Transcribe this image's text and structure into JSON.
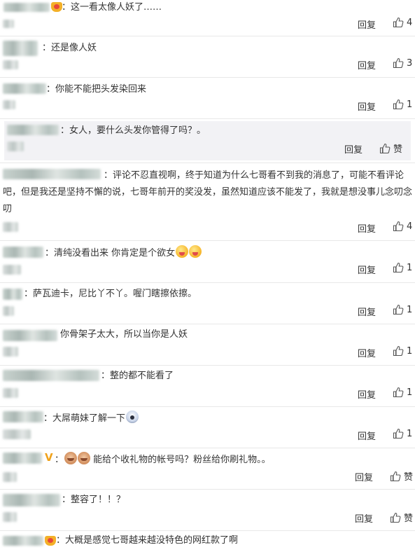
{
  "comments": [
    {
      "text": "：这一看太像人妖了……",
      "reply": "回复",
      "likes": "4"
    },
    {
      "text": "：还是像人妖",
      "reply": "回复",
      "likes": "3"
    },
    {
      "text": "：你能不能把头发染回来",
      "reply": "回复",
      "likes": "1"
    },
    {
      "text": "：女人，要什么头发你管得了吗？。",
      "reply": "回复",
      "likes": "赞"
    },
    {
      "text": "：评论不忍直视啊，终于知道为什么七哥看不到我的消息了，可能不看评论吧，但是我还是坚持不懈的说，七哥年前开的奖没发，虽然知道应该不能发了，我就是想没事儿念叨念叨",
      "reply": "回复",
      "likes": "4"
    },
    {
      "text": "：清纯没看出来 你肯定是个欲女",
      "reply": "回复",
      "likes": "1"
    },
    {
      "text": "：萨瓦迪卡，尼比丫不丫。喔门瞎擦依擦。",
      "reply": "回复",
      "likes": "1"
    },
    {
      "text": "你骨架子太大，所以当你是人妖",
      "reply": "回复",
      "likes": "1"
    },
    {
      "text": "：整的都不能看了",
      "reply": "回复",
      "likes": "1"
    },
    {
      "text": "：大屌萌妹了解一下",
      "reply": "回复",
      "likes": "1"
    },
    {
      "text": "：",
      "text2": "能给个收礼物的帐号吗？粉丝给你刷礼物。。",
      "reply": "回复",
      "likes": "赞"
    },
    {
      "text": "：整容了！！？",
      "reply": "回复",
      "likes": "赞"
    },
    {
      "text": "：大概是感觉七哥越来越没特色的网红款了啊",
      "reply": "",
      "likes": ""
    }
  ],
  "icons": {
    "like": "thumbs-up-icon",
    "vip": "crown-badge-icon",
    "emoji": "emoji-icon"
  },
  "colors": {
    "vip_v": "#f0a21b",
    "subcomment_bg": "#f2f2f5"
  }
}
